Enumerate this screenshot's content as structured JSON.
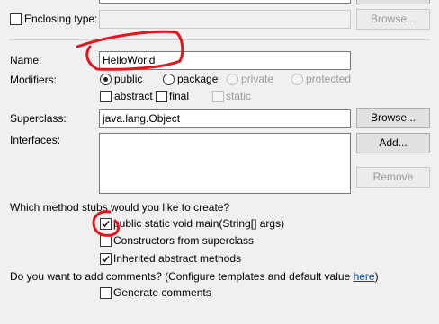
{
  "enclosing_type": {
    "label": "Enclosing type:",
    "browse_label": "Browse..."
  },
  "name": {
    "label": "Name:",
    "value": "HelloWorld"
  },
  "modifiers": {
    "label": "Modifiers:",
    "public_label": "public",
    "package_label": "package",
    "private_label": "private",
    "protected_label": "protected",
    "abstract_label": "abstract",
    "final_label": "final",
    "static_label": "static",
    "selected": "public"
  },
  "superclass": {
    "label": "Superclass:",
    "value": "java.lang.Object",
    "browse_label": "Browse..."
  },
  "interfaces": {
    "label": "Interfaces:",
    "add_label": "Add...",
    "remove_label": "Remove"
  },
  "method_stubs": {
    "question": "Which method stubs would you like to create?",
    "main_label": "public static void main(String[] args)",
    "main_checked": true,
    "constructors_label": "Constructors from superclass",
    "constructors_checked": false,
    "inherited_label": "Inherited abstract methods",
    "inherited_checked": true
  },
  "comments": {
    "question_prefix": "Do you want to add comments? (Configure templates and default value ",
    "link_text": "here",
    "question_suffix": ")",
    "generate_label": "Generate comments",
    "generate_checked": false
  },
  "annotation_color": "#e8141c"
}
